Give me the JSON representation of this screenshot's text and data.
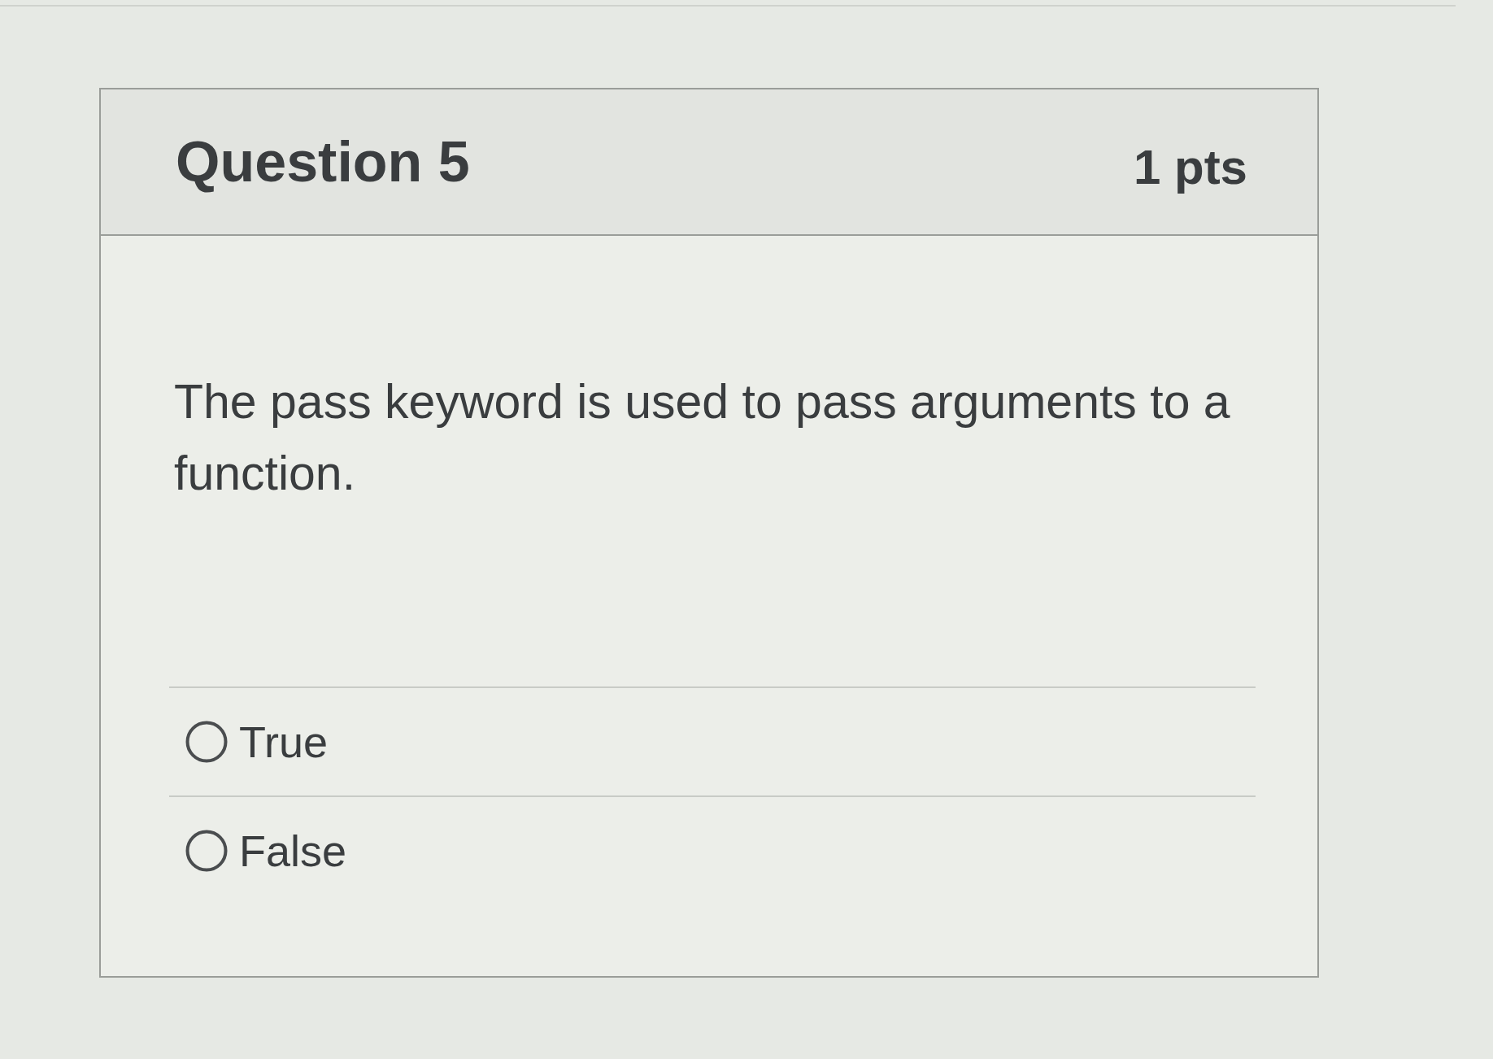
{
  "question": {
    "title": "Question 5",
    "points": "1 pts",
    "text": "The pass keyword is used to pass arguments to a function."
  },
  "answers": [
    {
      "label": "True",
      "selected": false
    },
    {
      "label": "False",
      "selected": false
    }
  ]
}
